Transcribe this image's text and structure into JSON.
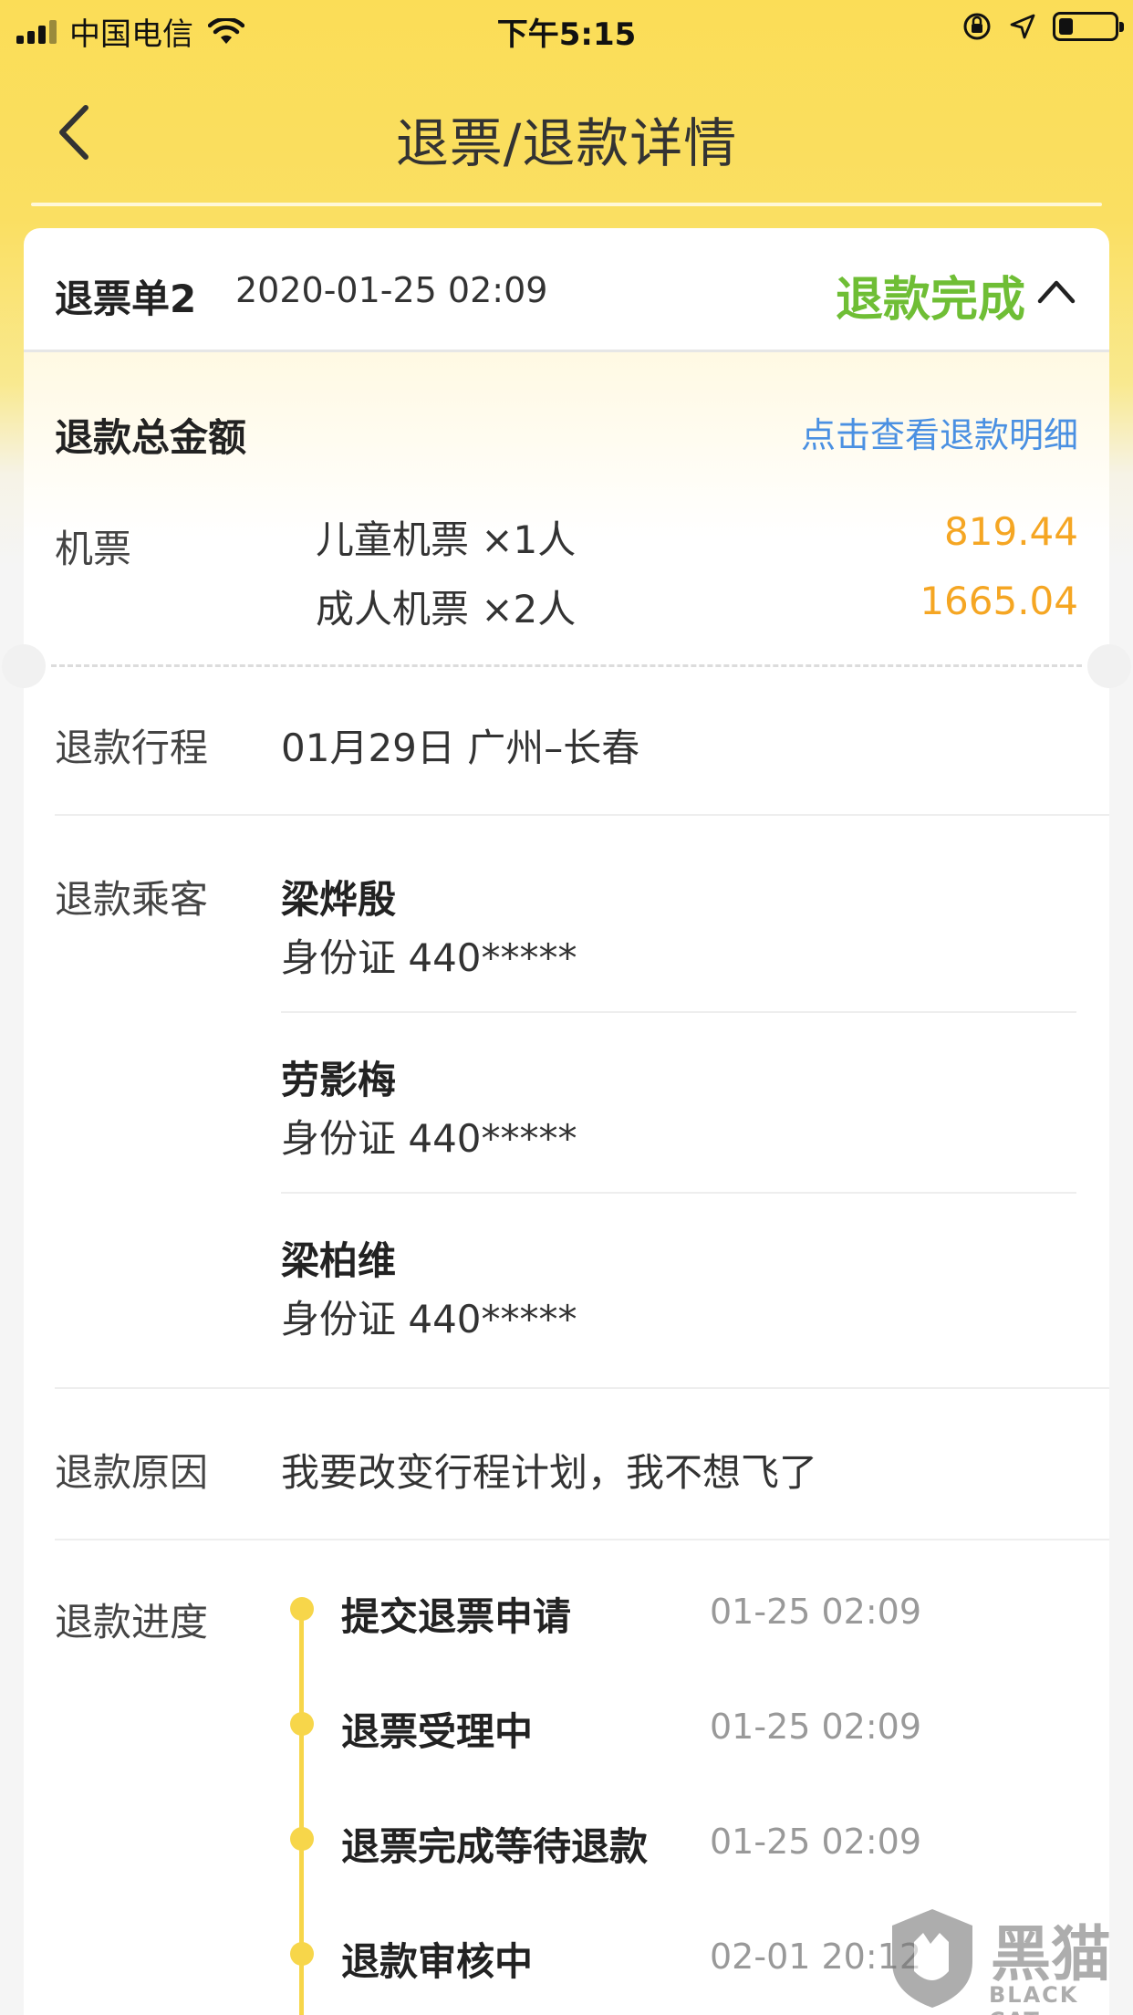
{
  "status_bar": {
    "carrier": "中国电信",
    "time": "下午5:15",
    "battery_level": 0.25
  },
  "nav": {
    "title": "退票/退款详情"
  },
  "order": {
    "title": "退票单2",
    "time": "2020-01-25 02:09",
    "status": "退款完成"
  },
  "refund_total": {
    "label": "退款总金额",
    "detail_link": "点击查看退款明细",
    "ticket_label": "机票",
    "tickets": [
      {
        "desc": "儿童机票 ×1人",
        "amount": "819.44"
      },
      {
        "desc": "成人机票 ×2人",
        "amount": "1665.04"
      }
    ]
  },
  "itinerary": {
    "label": "退款行程",
    "value": "01月29日 广州–长春"
  },
  "passengers": {
    "label": "退款乘客",
    "items": [
      {
        "name": "梁烨殷",
        "id": "身份证  440*****"
      },
      {
        "name": "劳影梅",
        "id": "身份证  440*****"
      },
      {
        "name": "梁柏维",
        "id": "身份证  440*****"
      }
    ]
  },
  "reason": {
    "label": "退款原因",
    "value": "我要改变行程计划，我不想飞了"
  },
  "progress": {
    "label": "退款进度",
    "steps": [
      {
        "title": "提交退票申请",
        "time": "01-25 02:09"
      },
      {
        "title": "退票受理中",
        "time": "01-25 02:09"
      },
      {
        "title": "退票完成等待退款",
        "time": "01-25 02:09"
      },
      {
        "title": "退款审核中",
        "time": "02-01 20:12"
      }
    ]
  },
  "watermark": {
    "cn": "黑猫",
    "en": "BLACK CAT"
  },
  "colors": {
    "header_yellow": "#fbdd57",
    "status_green": "#6fbe35",
    "amount_orange": "#f5a623",
    "link_blue": "#4a90e2",
    "timeline_yellow": "#f7d64a"
  }
}
